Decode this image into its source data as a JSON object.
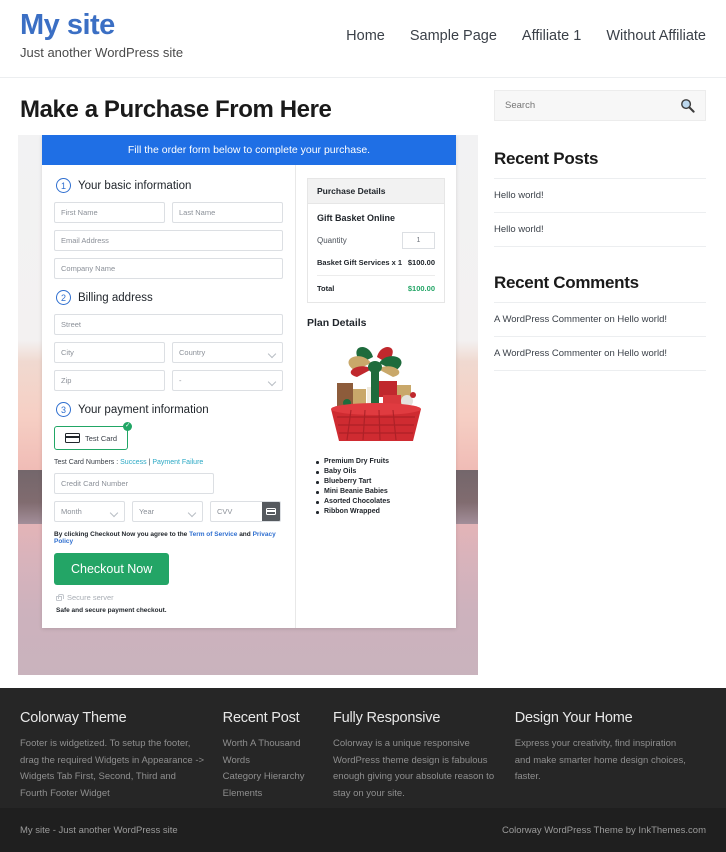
{
  "header": {
    "brand_title": "My site",
    "tagline": "Just another WordPress site",
    "nav": [
      {
        "label": "Home"
      },
      {
        "label": "Sample Page"
      },
      {
        "label": "Affiliate 1"
      },
      {
        "label": "Without Affiliate"
      }
    ]
  },
  "main": {
    "page_title": "Make a Purchase From Here",
    "banner": "Fill the order form below to complete your purchase.",
    "steps": {
      "step1_num": "1",
      "step1_label": "Your basic information",
      "step2_num": "2",
      "step2_label": "Billing address",
      "step3_num": "3",
      "step3_label": "Your payment information"
    },
    "fields": {
      "first_name": "First Name",
      "last_name": "Last Name",
      "email": "Email Address",
      "company": "Company Name",
      "street": "Street",
      "city": "City",
      "country": "Country",
      "zip": "Zip",
      "state": "-",
      "card_number": "Credit Card Number",
      "month": "Month",
      "year": "Year",
      "cvv": "CVV"
    },
    "payment": {
      "method_label": "Test Card",
      "check_mark": "✓",
      "test_note_prefix": "Test Card Numbers : ",
      "test_success": "Success",
      "test_separator": " | ",
      "test_failure": "Payment Failure",
      "terms_prefix": "By clicking Checkout Now you agree to the ",
      "terms_tos": "Term of Service",
      "terms_and": " and ",
      "terms_privacy": "Privacy Policy",
      "checkout_button": "Checkout Now",
      "secure_server": "Secure server",
      "safe_note": "Safe and secure payment checkout."
    },
    "summary": {
      "title": "Purchase Details",
      "product": "Gift Basket Online",
      "quantity_label": "Quantity",
      "quantity_value": "1",
      "line_item": "Basket Gift Services x 1",
      "line_price": "$100.00",
      "total_label": "Total",
      "total_price": "$100.00",
      "plan_title": "Plan Details",
      "plan_items": [
        "Premium Dry Fruits",
        "Baby Oils",
        "Blueberry Tart",
        "Mini Beanie Babies",
        "Asorted Chocolates",
        "Ribbon Wrapped"
      ]
    }
  },
  "sidebar": {
    "search_placeholder": "Search",
    "recent_posts_title": "Recent Posts",
    "recent_posts": [
      {
        "label": "Hello world!"
      },
      {
        "label": "Hello world!"
      }
    ],
    "recent_comments_title": "Recent Comments",
    "recent_comments": [
      {
        "label": "A WordPress Commenter on Hello world!"
      },
      {
        "label": "A WordPress Commenter on Hello world!"
      }
    ]
  },
  "footer": {
    "columns": [
      {
        "title": "Colorway Theme",
        "text": "Footer is widgetized. To setup the footer, drag the required Widgets in Appearance -> Widgets Tab First, Second, Third and Fourth Footer Widget"
      },
      {
        "title": "Recent Post",
        "items": [
          {
            "label": "Worth A Thousand Words"
          },
          {
            "label": "Category Hierarchy"
          },
          {
            "label": "Elements"
          }
        ]
      },
      {
        "title": "Fully Responsive",
        "text": "Colorway is a unique responsive WordPress theme design is fabulous enough giving your absolute reason to stay on your site."
      },
      {
        "title": "Design Your Home",
        "text": "Express your creativity, find inspiration and make smarter home design choices, faster."
      }
    ],
    "bottom_left": "My site - Just another WordPress site",
    "bottom_right": "Colorway WordPress Theme by InkThemes.com"
  },
  "colors": {
    "brand_blue": "#3b6fc4",
    "banner_blue": "#1f6fe5",
    "green": "#23a566",
    "link_teal": "#2aa8c4"
  }
}
